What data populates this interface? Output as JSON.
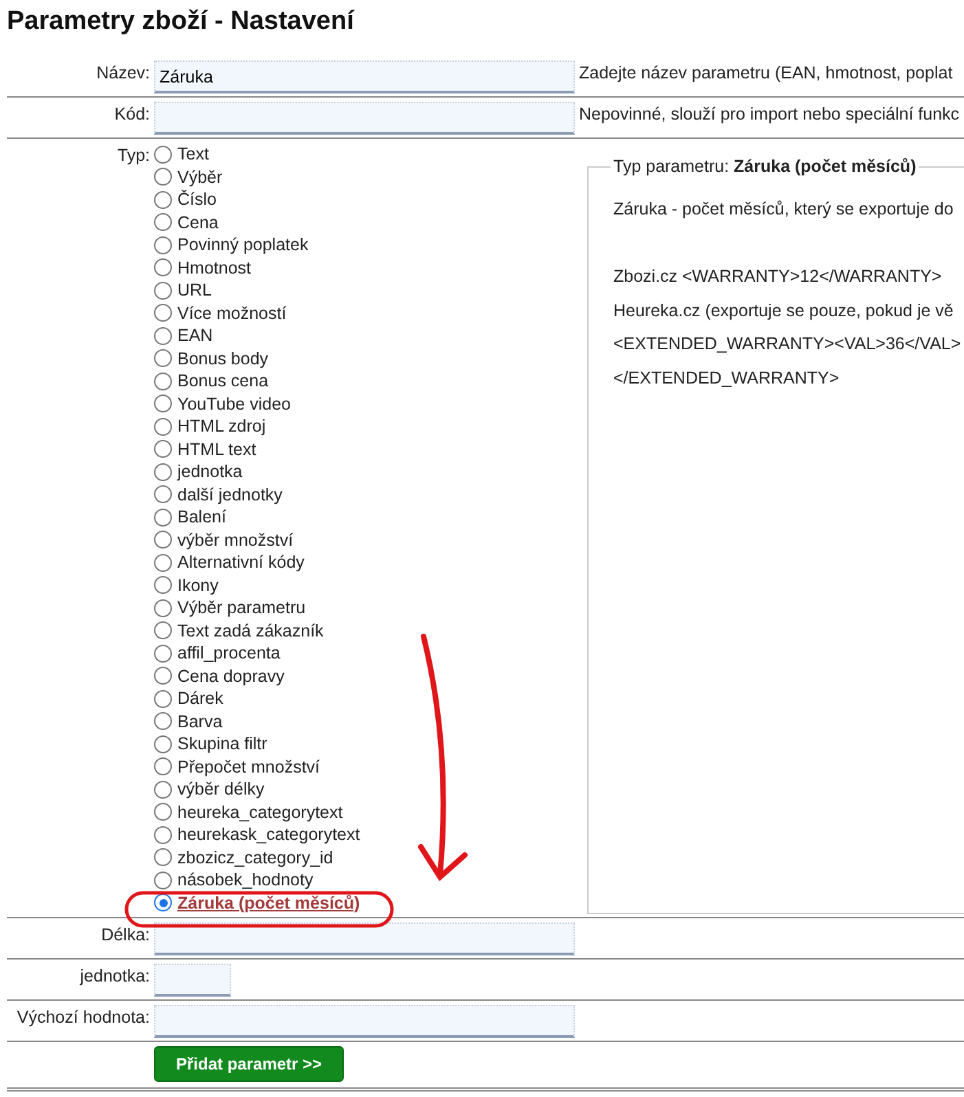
{
  "title": "Parametry zboží - Nastavení",
  "fields": [
    {
      "label": "Název:",
      "value": "Záruka",
      "hint": "Zadejte název parametru (EAN, hmotnost, poplat"
    },
    {
      "label": "Kód:",
      "hint": "Nepovinné, slouží pro import nebo speciální funkc"
    }
  ],
  "type": {
    "label": "Typ:",
    "options": [
      {
        "label": "Text",
        "selected": false
      },
      {
        "label": "Výběr",
        "selected": false
      },
      {
        "label": "Číslo",
        "selected": false
      },
      {
        "label": "Cena",
        "selected": false
      },
      {
        "label": "Povinný poplatek",
        "selected": false
      },
      {
        "label": "Hmotnost",
        "selected": false
      },
      {
        "label": "URL",
        "selected": false
      },
      {
        "label": "Více možností",
        "selected": false
      },
      {
        "label": "EAN",
        "selected": false
      },
      {
        "label": "Bonus body",
        "selected": false
      },
      {
        "label": "Bonus cena",
        "selected": false
      },
      {
        "label": "YouTube video",
        "selected": false
      },
      {
        "label": "HTML zdroj",
        "selected": false
      },
      {
        "label": "HTML text",
        "selected": false
      },
      {
        "label": "jednotka",
        "selected": false
      },
      {
        "label": "další jednotky",
        "selected": false
      },
      {
        "label": "Balení",
        "selected": false
      },
      {
        "label": "výběr množství",
        "selected": false
      },
      {
        "label": "Alternativní kódy",
        "selected": false
      },
      {
        "label": "Ikony",
        "selected": false
      },
      {
        "label": "Výběr parametru",
        "selected": false
      },
      {
        "label": "Text zadá zákazník",
        "selected": false
      },
      {
        "label": "affil_procenta",
        "selected": false
      },
      {
        "label": "Cena dopravy",
        "selected": false
      },
      {
        "label": "Dárek",
        "selected": false
      },
      {
        "label": "Barva",
        "selected": false
      },
      {
        "label": "Skupina filtr",
        "selected": false
      },
      {
        "label": "Přepočet množství",
        "selected": false
      },
      {
        "label": "výběr délky",
        "selected": false
      },
      {
        "label": "heureka_categorytext",
        "selected": false
      },
      {
        "label": "heurekask_categorytext",
        "selected": false
      },
      {
        "label": "zbozicz_category_id",
        "selected": false
      },
      {
        "label": "násobek_hodnoty",
        "selected": false
      },
      {
        "label": "Záruka (počet měsíců)",
        "selected": true
      }
    ],
    "info": {
      "legend": "Typ parametru: **Záruka (počet měsíců)**",
      "lines": [
        "Záruka - počet měsíců, který se exportuje do",
        "Zbozi.cz <WARRANTY>12</WARRANTY>",
        "Heureka.cz (exportuje se pouze, pokud je vě",
        "<EXTENDED_WARRANTY><VAL>36</VAL>",
        "</EXTENDED_WARRANTY>"
      ]
    }
  },
  "extra_fields": [
    {
      "label": "Délka:",
      "kind": "wide"
    },
    {
      "label": "jednotka:",
      "kind": "short"
    },
    {
      "label": "Výchozí hodnota:",
      "kind": "wide"
    }
  ],
  "submit": "Přidat parametr >>"
}
